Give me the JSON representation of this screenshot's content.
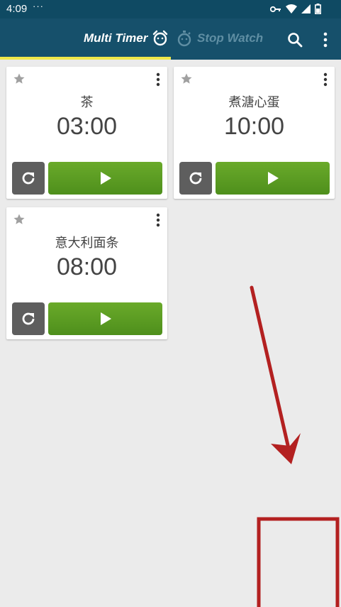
{
  "status_bar": {
    "time": "4:09",
    "dots": "···"
  },
  "app_bar": {
    "tabs": [
      {
        "label": "Multi Timer",
        "selected": true
      },
      {
        "label": "Stop Watch",
        "selected": false
      }
    ],
    "accent": "#f0e84a"
  },
  "timers": [
    {
      "name": "茶",
      "time": "03:00"
    },
    {
      "name": "煮溏心蛋",
      "time": "10:00"
    },
    {
      "name": "意大利面条",
      "time": "08:00"
    }
  ],
  "colors": {
    "annotation": "#b32020",
    "play": "#5a9b22",
    "reset": "#5e5e5e"
  }
}
